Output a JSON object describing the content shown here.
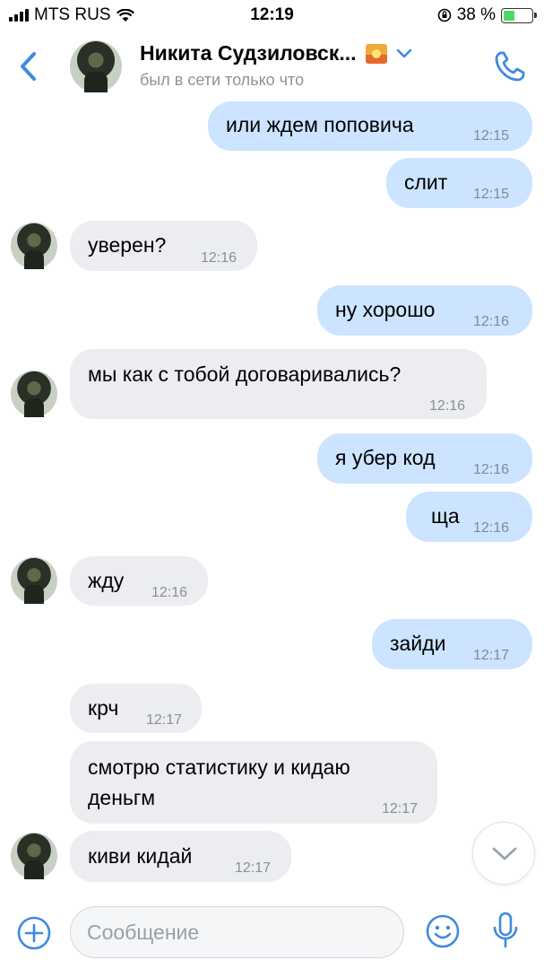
{
  "status_bar": {
    "carrier": "MTS RUS",
    "time": "12:19",
    "battery": "38 %"
  },
  "header": {
    "contact_name": "Никита Судзиловск...",
    "presence": "был в сети только что"
  },
  "messages": [
    {
      "dir": "out",
      "text": "или ждем поповича",
      "time": "12:15"
    },
    {
      "dir": "out",
      "text": "слит",
      "time": "12:15"
    },
    {
      "dir": "in",
      "text": "уверен?",
      "time": "12:16"
    },
    {
      "dir": "out",
      "text": "ну хорошо",
      "time": "12:16"
    },
    {
      "dir": "in",
      "text": "мы как с тобой договаривались?",
      "time": "12:16"
    },
    {
      "dir": "out",
      "text": "я убер код",
      "time": "12:16"
    },
    {
      "dir": "out",
      "text": "ща",
      "time": "12:16"
    },
    {
      "dir": "in",
      "text": "жду",
      "time": "12:16"
    },
    {
      "dir": "out",
      "text": "зайди",
      "time": "12:17"
    },
    {
      "dir": "in",
      "text": "крч",
      "time": "12:17"
    },
    {
      "dir": "in",
      "text": "смотрю статистику и кидаю",
      "text2": "деньгм",
      "time": "12:17"
    },
    {
      "dir": "in",
      "text": "киви кидай",
      "time": "12:17"
    }
  ],
  "composer": {
    "placeholder": "Сообщение"
  },
  "icons": {
    "back": "chevron-left-icon",
    "call": "phone-icon",
    "attach": "plus-circle-icon",
    "emoji": "smile-icon",
    "voice": "microphone-icon",
    "scroll": "chevron-down-icon"
  },
  "colors": {
    "accent": "#3f8ae0",
    "outgoing_bubble": "#cce4ff",
    "incoming_bubble": "#ecedf1"
  }
}
